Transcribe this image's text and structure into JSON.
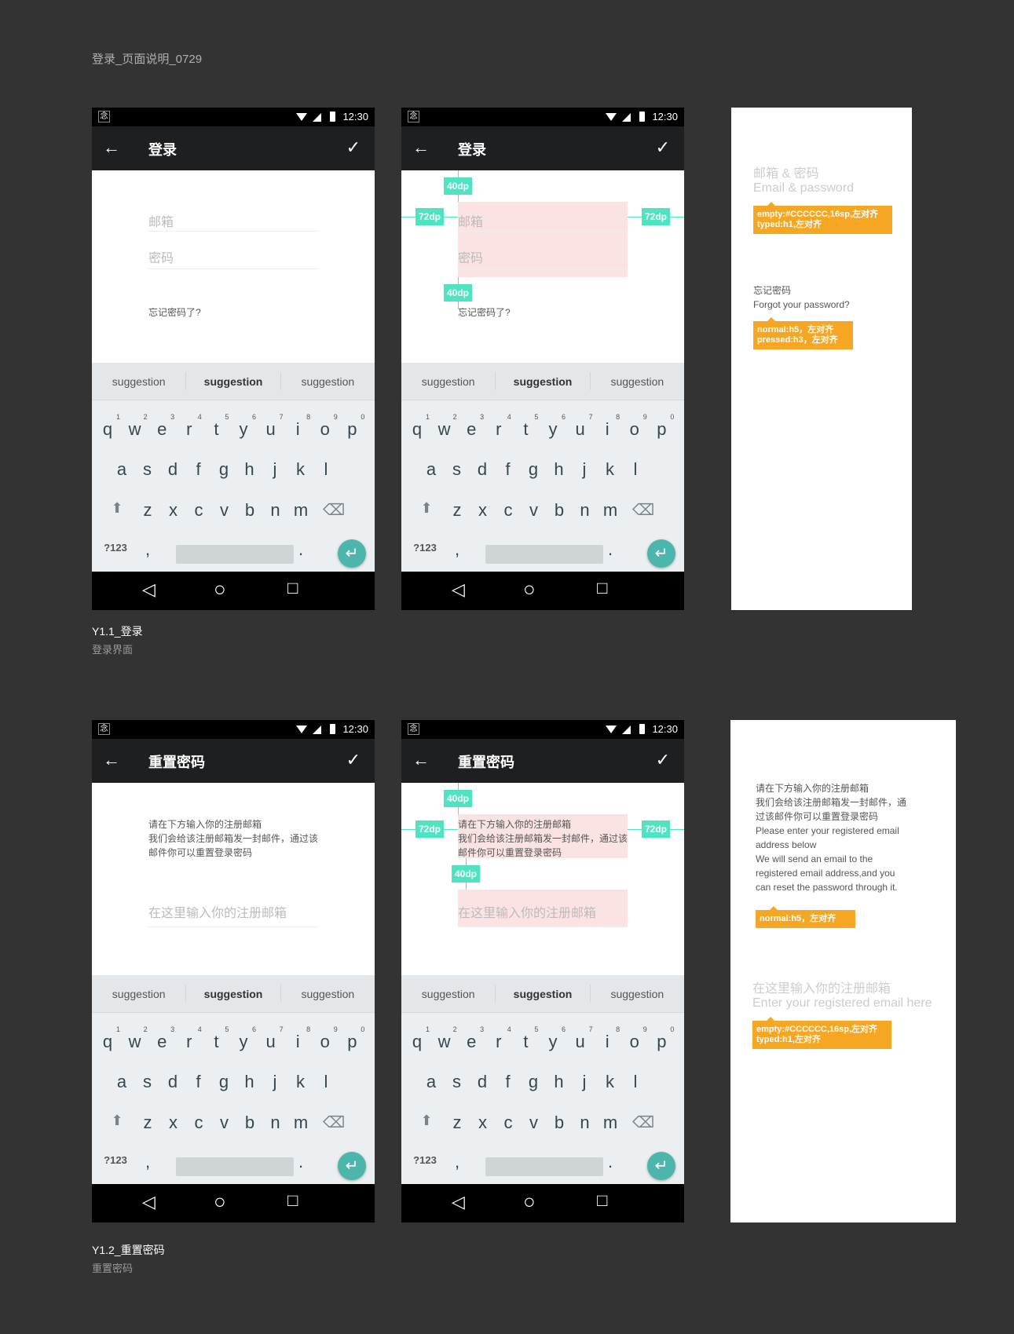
{
  "page_title": "登录_页面说明_0729",
  "status": {
    "time": "12:30",
    "app_icon": "念"
  },
  "keyboard": {
    "suggestions": [
      "suggestion",
      "suggestion",
      "suggestion"
    ],
    "row1": [
      "q",
      "w",
      "e",
      "r",
      "t",
      "y",
      "u",
      "i",
      "o",
      "p"
    ],
    "nums": [
      "1",
      "2",
      "3",
      "4",
      "5",
      "6",
      "7",
      "8",
      "9",
      "0"
    ],
    "row2": [
      "a",
      "s",
      "d",
      "f",
      "g",
      "h",
      "j",
      "k",
      "l"
    ],
    "row3": [
      "z",
      "x",
      "c",
      "v",
      "b",
      "n",
      "m"
    ],
    "sym": "?123",
    "comma": ",",
    "period": "."
  },
  "icons": {
    "back": "←",
    "check": "✓",
    "shift": "⬆",
    "delete": "⌫",
    "enter": "↵",
    "nav_back": "◁",
    "nav_home": "○",
    "nav_recent": "□"
  },
  "dims": {
    "top": "40dp",
    "side": "72dp"
  },
  "login": {
    "title": "登录",
    "email": "邮箱",
    "password": "密码",
    "forgot": "忘记密码了?",
    "caption": "Y1.1_登录",
    "subcaption": "登录界面"
  },
  "reset": {
    "title": "重置密码",
    "desc": [
      "请在下方输入你的注册邮箱",
      "我们会给该注册邮箱发一封邮件，通过该",
      "邮件你可以重置登录密码"
    ],
    "input": "在这里输入你的注册邮箱",
    "caption": "Y1.2_重置密码",
    "subcaption": "重置密码"
  },
  "spec1": {
    "h1": "邮箱 & 密码",
    "h2": "Email & password",
    "tag1": [
      "empty:#CCCCCC,16sp,左对齐",
      "typed:h1,左对齐"
    ],
    "f1": "忘记密码",
    "f2": "Forgot your password?",
    "tag2": [
      "normal:h5，左对齐",
      "pressed:h3，左对齐"
    ]
  },
  "spec2": {
    "lines": [
      "请在下方输入你的注册邮箱",
      "我们会给该注册邮箱发一封邮件，通",
      "过该邮件你可以重置登录密码",
      "Please enter your registered email",
      "address below",
      "We will send an email to the",
      "registered email address,and you",
      "can reset the password through it."
    ],
    "tag1": [
      "normal:h5，左对齐"
    ],
    "p1": "在这里输入你的注册邮箱",
    "p2": "Enter your registered email here",
    "tag2": [
      "empty:#CCCCCC,16sp,左对齐",
      "typed:h1,左对齐"
    ]
  },
  "colors": {
    "annotation": "#50e3c2",
    "tag": "#f5a623",
    "accent": "#4db6ac"
  }
}
